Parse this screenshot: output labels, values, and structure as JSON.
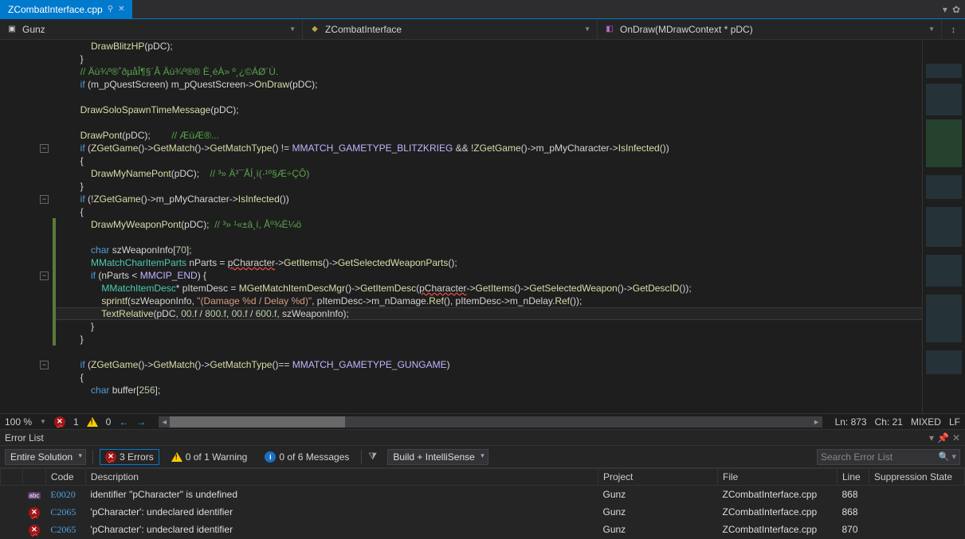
{
  "tab": {
    "title": "ZCombatInterface.cpp",
    "pin": "⚲",
    "close": "✕"
  },
  "nav": {
    "scope1": "Gunz",
    "scope2": "ZCombatInterface",
    "scope3": "OnDraw(MDrawContext * pDC)"
  },
  "status": {
    "zoom": "100 %",
    "errcount": "1",
    "warncount": "0",
    "line": "Ln: 873",
    "col": "Ch: 21",
    "ends": "MIXED",
    "lf": "LF"
  },
  "errorlist": {
    "title": "Error List",
    "scope": "Entire Solution",
    "errs": "3 Errors",
    "warns": "0 of 1 Warning",
    "msgs": "0 of 6 Messages",
    "build": "Build + IntelliSense",
    "search_ph": "Search Error List",
    "cols": {
      "code": "Code",
      "desc": "Description",
      "proj": "Project",
      "file": "File",
      "line": "Line",
      "supp": "Suppression State"
    },
    "rows": [
      {
        "icon": "abc",
        "code": "E0020",
        "desc": "identifier \"pCharacter\" is undefined",
        "proj": "Gunz",
        "file": "ZCombatInterface.cpp",
        "line": "868"
      },
      {
        "icon": "err",
        "code": "C2065",
        "desc": "'pCharacter': undeclared identifier",
        "proj": "Gunz",
        "file": "ZCombatInterface.cpp",
        "line": "868"
      },
      {
        "icon": "err",
        "code": "C2065",
        "desc": "'pCharacter': undeclared identifier",
        "proj": "Gunz",
        "file": "ZCombatInterface.cpp",
        "line": "870"
      }
    ]
  },
  "code_lines": [
    {
      "i": 0,
      "html": "            <span class='fn'>DrawBlitzHP</span>(pDC);"
    },
    {
      "i": 0,
      "html": "        }"
    },
    {
      "i": 0,
      "html": "        <span class='cm'>// Äù¾º®˚ðµåÎ¶§´Â Äù¾º®® È¸éÀ» º¸¿©ÁØ´Ù.</span>"
    },
    {
      "i": 0,
      "html": "        <span class='kw'>if</span> (m_pQuestScreen) m_pQuestScreen-&gt;<span class='fn'>OnDraw</span>(pDC);"
    },
    {
      "i": 0,
      "html": ""
    },
    {
      "i": 0,
      "html": "        <span class='fn'>DrawSoloSpawnTimeMessage</span>(pDC);"
    },
    {
      "i": 0,
      "html": ""
    },
    {
      "i": 0,
      "html": "        <span class='fn'>DrawPont</span>(pDC);        <span class='cm'>// ÆùÆ®...</span>"
    },
    {
      "i": 0,
      "fold": "-",
      "html": "        <span class='kw'>if</span> (<span class='fn'>ZGetGame</span>()-&gt;<span class='fn'>GetMatch</span>()-&gt;<span class='fn'>GetMatchType</span>() != <span class='mac'>MMATCH_GAMETYPE_BLITZKRIEG</span> &amp;&amp; !<span class='fn'>ZGetGame</span>()-&gt;m_pMyCharacter-&gt;<span class='fn'>IsInfected</span>())"
    },
    {
      "i": 0,
      "html": "        {"
    },
    {
      "i": 0,
      "html": "            <span class='fn'>DrawMyNamePont</span>(pDC);    <span class='cm'>// ³» Ä³¯ÅÍ¸í(·¹º§Æ÷ÇÔ)</span>"
    },
    {
      "i": 0,
      "html": "        }"
    },
    {
      "i": 0,
      "fold": "-",
      "html": "        <span class='kw'>if</span> (!<span class='fn'>ZGetGame</span>()-&gt;m_pMyCharacter-&gt;<span class='fn'>IsInfected</span>())"
    },
    {
      "i": 0,
      "html": "        {"
    },
    {
      "i": 0,
      "mod": 1,
      "html": "            <span class='fn'>DrawMyWeaponPont</span>(pDC);  <span class='cm'>// ³» ¹«±â¸í, Åº¾Ë¼ö</span>"
    },
    {
      "i": 0,
      "mod": 1,
      "html": ""
    },
    {
      "i": 0,
      "mod": 1,
      "html": "            <span class='kw'>char</span> szWeaponInfo[<span class='num'>70</span>];"
    },
    {
      "i": 0,
      "mod": 1,
      "html": "            <span class='typ'>MMatchCharItemParts</span> nParts = <span class='err'>pCharacter</span>-&gt;<span class='fn'>GetItems</span>()-&gt;<span class='fn'>GetSelectedWeaponParts</span>();"
    },
    {
      "i": 0,
      "mod": 1,
      "fold": "-",
      "html": "            <span class='kw'>if</span> (nParts &lt; <span class='mac'>MMCIP_END</span>) {"
    },
    {
      "i": 0,
      "mod": 1,
      "html": "                <span class='typ'>MMatchItemDesc</span>* pItemDesc = <span class='fn'>MGetMatchItemDescMgr</span>()-&gt;<span class='fn'>GetItemDesc</span>(<span class='err'>pCharacter</span>-&gt;<span class='fn'>GetItems</span>()-&gt;<span class='fn'>GetSelectedWeapon</span>()-&gt;<span class='fn'>GetDescID</span>());"
    },
    {
      "i": 0,
      "mod": 1,
      "html": "                <span class='fn'>sprintf</span>(szWeaponInfo, <span class='str'>\"(Damage %d / Delay %d)\"</span>, pItemDesc-&gt;m_nDamage.<span class='fn'>Ref</span>(), pItemDesc-&gt;m_nDelay.<span class='fn'>Ref</span>());"
    },
    {
      "i": 0,
      "mod": 1,
      "hl": 1,
      "html": "                <span class='fn'>TextRelative</span>(pDC, <span class='num'>00.f</span> / <span class='num'>800.f</span>, <span class='num'>00.f</span> / <span class='num'>600.f</span>, szWeaponInfo);"
    },
    {
      "i": 0,
      "mod": 1,
      "html": "            }"
    },
    {
      "i": 0,
      "mod": 1,
      "html": "        }"
    },
    {
      "i": 0,
      "html": ""
    },
    {
      "i": 0,
      "fold": "-",
      "html": "        <span class='kw'>if</span> (<span class='fn'>ZGetGame</span>()-&gt;<span class='fn'>GetMatch</span>()-&gt;<span class='fn'>GetMatchType</span>()== <span class='mac'>MMATCH_GAMETYPE_GUNGAME</span>)"
    },
    {
      "i": 0,
      "html": "        {"
    },
    {
      "i": 0,
      "html": "            <span class='kw'>char</span> buffer[<span class='num'>256</span>];"
    }
  ]
}
